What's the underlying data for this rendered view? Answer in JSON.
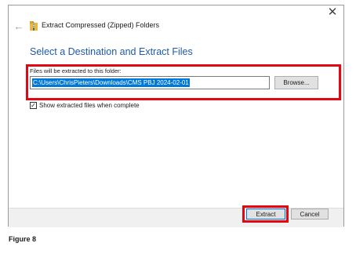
{
  "dialog": {
    "title": "Extract Compressed (Zipped) Folders",
    "heading": "Select a Destination and Extract Files",
    "close_glyph": "✕",
    "back_glyph": "←",
    "icons": {
      "close": "close-icon",
      "back": "back-arrow-icon",
      "title": "zip-folder-icon"
    }
  },
  "destination": {
    "label": "Files will be extracted to this folder:",
    "value": "C:\\Users\\ChrisPieters\\Downloads\\CMS PBJ 2024-02-01",
    "browse_label": "Browse..."
  },
  "options": {
    "show_files_label": "Show extracted files when complete",
    "show_files_checked": true
  },
  "footer": {
    "extract_label": "Extract",
    "cancel_label": "Cancel"
  },
  "caption": "Figure 8",
  "colors": {
    "heading": "#1f5aa8",
    "highlight": "#e30613",
    "selection": "#0078d7"
  }
}
